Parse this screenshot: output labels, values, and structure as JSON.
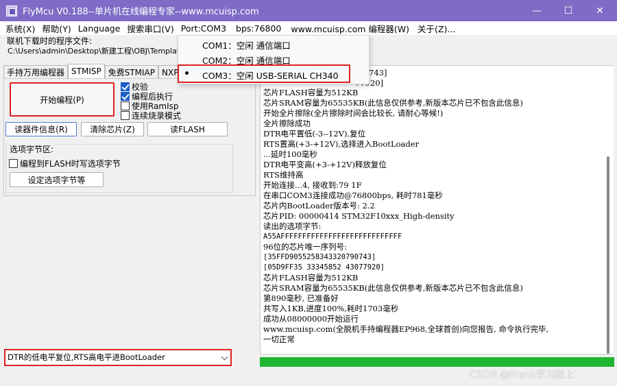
{
  "window": {
    "title": "FlyMcu V0.188--单片机在线编程专家--www.mcuisp.com",
    "minimize": "—",
    "maximize": "☐",
    "close": "✕"
  },
  "menu": [
    "系统(X)",
    "帮助(Y)",
    "Language",
    "搜索串口(V)",
    "Port:COM3",
    "bps:76800",
    "www.mcuisp.com 编程器(W)",
    "关于(Z)..."
  ],
  "file": {
    "label": "联机下载时的程序文件:",
    "path": "C:\\Users\\admin\\Desktop\\新建工程\\OBJ\\Template.h"
  },
  "tabs": [
    "手持万用编程器",
    "STMISP",
    "免费STMIAP",
    "NXP IS"
  ],
  "buttons": {
    "program": "开始编程(P)",
    "read_info": "读器件信息(R)",
    "erase": "清除芯片(Z)",
    "read_flash": "读FLASH",
    "config": "设定选项字节等"
  },
  "checkboxes": [
    {
      "label": "校验",
      "checked": true
    },
    {
      "label": "编程后执行",
      "checked": true
    },
    {
      "label": "使用RamIsp",
      "checked": false
    },
    {
      "label": "连续烧录模式",
      "checked": false
    }
  ],
  "option_group": {
    "title": "选项字节区:",
    "checkbox_label": "编程到FLASH时写选项字节"
  },
  "reset_mode": {
    "selected": "DTR的低电平复位,RTS高电平进BootLoader"
  },
  "port_menu": {
    "items": [
      "COM1：空闲 通信端口",
      "COM2：空闲 通信端口",
      "COM3：空闲 USB-SERIAL CH340"
    ],
    "selected_index": 2
  },
  "log": {
    "lines": [
      "743]",
      "77920]",
      "芯片FLASH容量为512KB",
      "芯片SRAM容量为65535KB(此信息仅供参考,新版本芯片已不包含此信息)",
      "开始全片擦除(全片擦除时间会比较长, 请耐心等候!)",
      "全片擦除成功",
      "DTR电平置低(-3--12V),复位",
      "RTS置高(+3-+12V),选择进入BootLoader",
      "...延时100毫秒",
      "DTR电平变高(+3-+12V)释放复位",
      "RTS维持高",
      "开始连接...4, 接收到:79 1F",
      "在串口COM3连接成功@76800bps, 耗时781毫秒",
      "芯片内BootLoader版本号: 2.2",
      "芯片PID: 00000414  STM32F10xxx_High-density",
      "读出的选项字节:",
      "A55AFFFFFFFFFFFFFFFFFFFFFFFFFFFF",
      "96位的芯片唯一序列号:",
      "[35FFD905525834332079074З]",
      "[05D9FF35 33345852 43077920]",
      "芯片FLASH容量为512KB",
      "芯片SRAM容量为65535KB(此信息仅供参考,新版本芯片已不包含此信息)",
      "第890毫秒, 已准备好",
      "共写入1KB,进度100%,耗时1703毫秒",
      "成功从08000000开始运行",
      "www.mcuisp.com(全脱机手持编程器EP968,全球首创)向您报告, 命令执行完毕,",
      "一切正常"
    ]
  },
  "progress": {
    "percent": 100,
    "color": "#1fb530"
  },
  "watermark": "CSDN @Frank学习路上",
  "colors": {
    "titlebar": "#7e6cc6",
    "highlight_red": "#e01f1f",
    "checkbox_blue": "#1c5fc8"
  }
}
